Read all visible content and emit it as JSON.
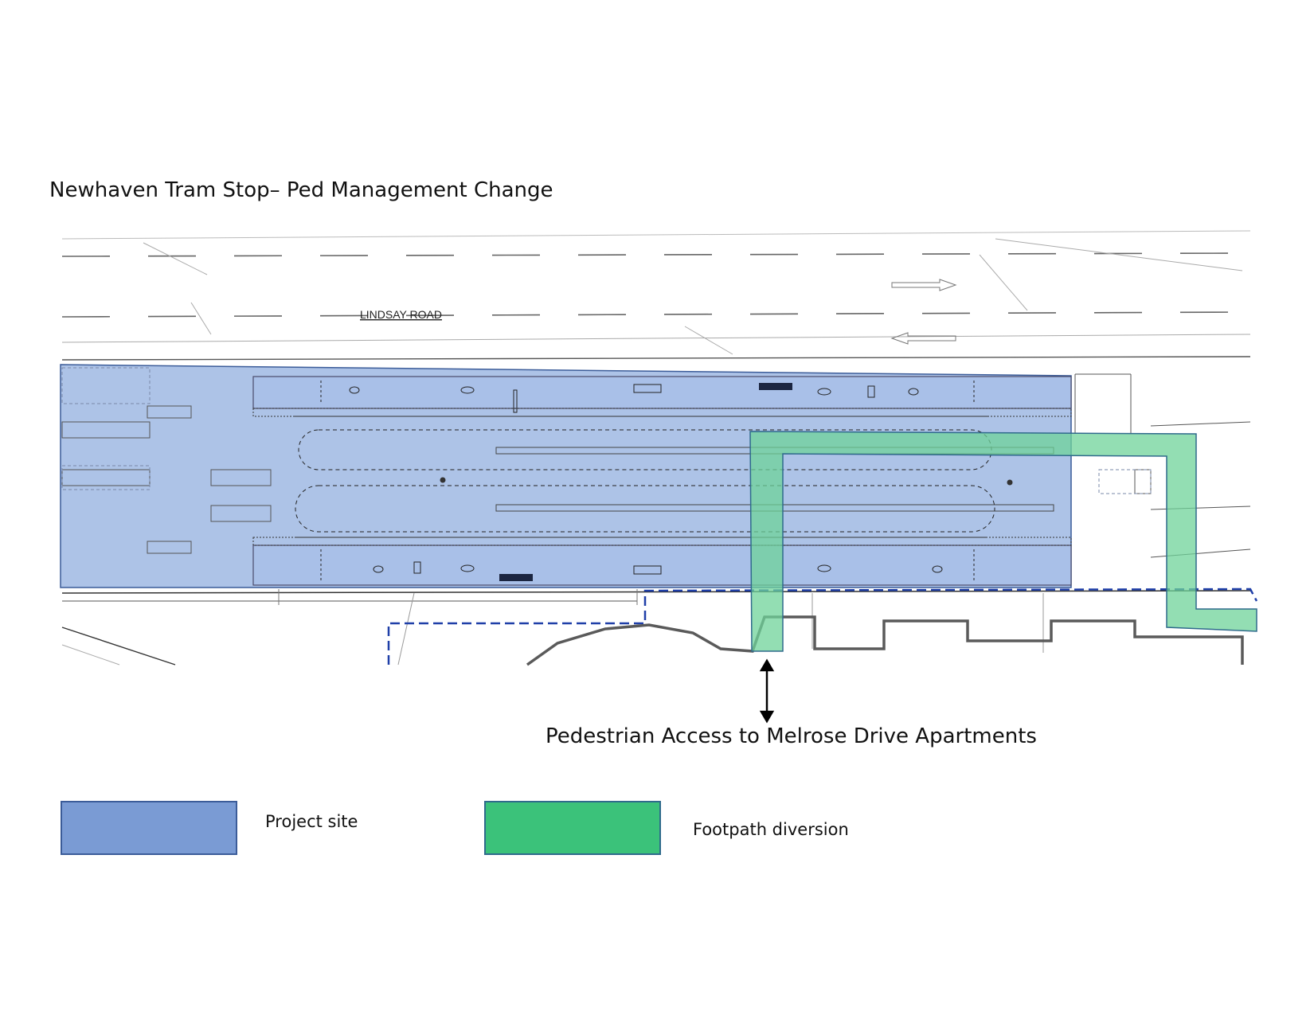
{
  "title": "Newhaven Tram Stop– Ped Management Change",
  "map": {
    "road_label": "LINDSAY ROAD",
    "access_label": "Pedestrian Access to Melrose Drive Apartments"
  },
  "legend": [
    {
      "label": "Project site",
      "color": "#7a9bd4",
      "border": "#3b5c99"
    },
    {
      "label": "Footpath diversion",
      "color": "#3bc27a",
      "border": "#2f6a8c"
    }
  ],
  "colors": {
    "project_fill": "#9fb8e3",
    "diversion_fill": "#6fd39a",
    "site_boundary_dash": "#1f3fa8",
    "kerb_line": "#5a5a5a"
  }
}
